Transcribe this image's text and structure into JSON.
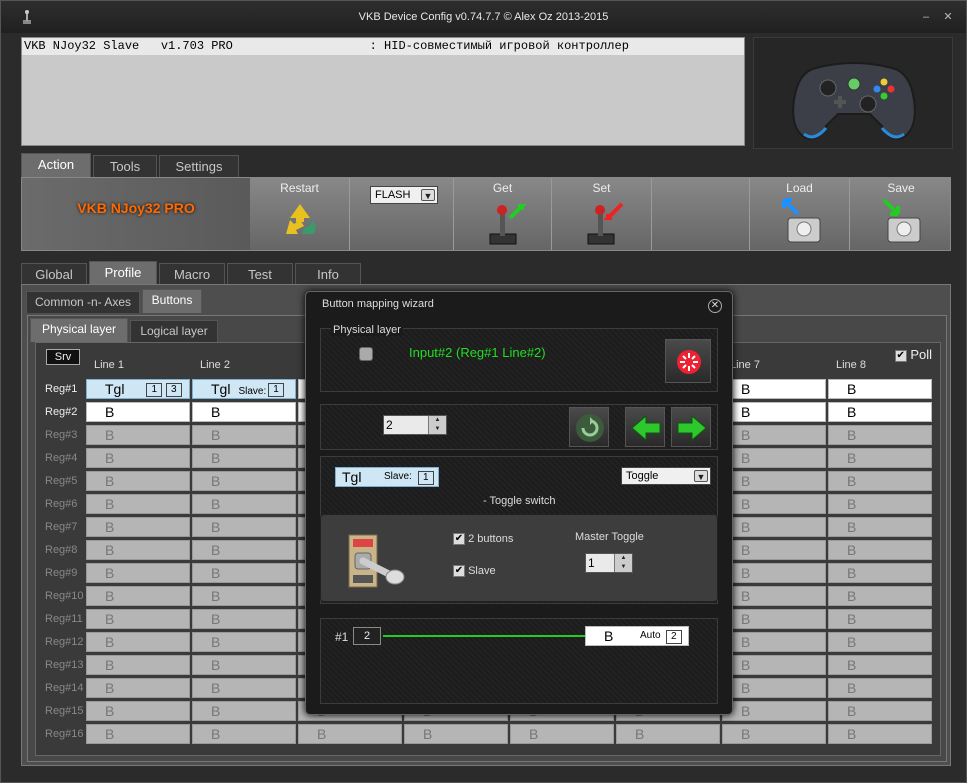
{
  "window": {
    "title": "VKB Device Config v0.74.7.7  © Alex Oz 2013-2015",
    "minimize": "–",
    "close": "✕"
  },
  "info": {
    "line": "VKB NJoy32 Slave   v1.703 PRO                   : HID-совместимый игровой контроллер"
  },
  "main_tabs": [
    "Action",
    "Tools",
    "Settings"
  ],
  "action": {
    "brand": "VKB NJoy32 PRO",
    "restart": "Restart",
    "flash": "FLASH",
    "get": "Get",
    "set": "Set",
    "load": "Load",
    "save": "Save"
  },
  "profile_tabs": [
    "Global",
    "Profile",
    "Macro",
    "Test",
    "Info"
  ],
  "sub_tabs": [
    "Common -n- Axes",
    "Buttons"
  ],
  "layer_tabs": [
    "Physical layer",
    "Logical layer"
  ],
  "grid": {
    "srv": "Srv",
    "poll": "Poll",
    "poll_check": "✔",
    "columns": [
      "Line 1",
      "Line 2",
      "Line 7",
      "Line 8"
    ],
    "rows": [
      "Reg#1",
      "Reg#2",
      "Reg#3",
      "Reg#4",
      "Reg#5",
      "Reg#6",
      "Reg#7",
      "Reg#8",
      "Reg#9",
      "Reg#10",
      "Reg#11",
      "Reg#12",
      "Reg#13",
      "Reg#14",
      "Reg#15",
      "Reg#16"
    ],
    "cell_text": "B",
    "tgl": "Tgl",
    "r1c1_a": "1",
    "r1c1_b": "3",
    "slave_label": "Slave:",
    "r1c2_slave": "1"
  },
  "wizard": {
    "title": "Button mapping wizard",
    "close": "✕",
    "physical_layer": "Physical layer",
    "input_text": "Input#2  (Reg#1  Line#2)",
    "spin_value": "2",
    "spin_up": "▲",
    "spin_down": "▼",
    "tgl": "Tgl",
    "slave_label": "Slave:",
    "slave_value": "1",
    "mode_select": "Toggle",
    "mode_desc": "- Toggle switch",
    "two_buttons": "2 buttons",
    "slave": "Slave",
    "check": "✔",
    "master_toggle": "Master Toggle",
    "master_value": "1",
    "map_index": "#1",
    "map_from": "2",
    "map_to_text": "B",
    "map_auto": "Auto",
    "map_to_value": "2"
  },
  "colors": {
    "accent_orange": "#ff6a00",
    "green_text": "#22dd22",
    "tgl_blue": "#cfe6f5"
  }
}
